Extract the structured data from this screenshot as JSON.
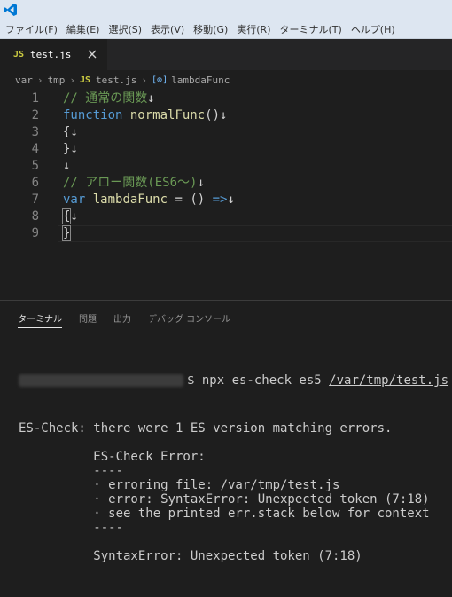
{
  "app": {
    "accent": "#0078d4",
    "icon": "vscode-logo"
  },
  "menu": [
    "ファイル(F)",
    "編集(E)",
    "選択(S)",
    "表示(V)",
    "移動(G)",
    "実行(R)",
    "ターミナル(T)",
    "ヘルプ(H)"
  ],
  "tab": {
    "badge": "JS",
    "label": "test.js",
    "close_icon": "close-icon"
  },
  "breadcrumb": {
    "items": [
      "var",
      "tmp",
      "test.js",
      "lambdaFunc"
    ],
    "file_badge": "JS",
    "symbol_icon": "cube-icon"
  },
  "editor": {
    "line_numbers": [
      "1",
      "2",
      "3",
      "4",
      "5",
      "6",
      "7",
      "8",
      "9"
    ],
    "lines": [
      [
        {
          "t": "// 通常の関数",
          "c": "cm"
        },
        {
          "t": "↓",
          "c": "nl"
        }
      ],
      [
        {
          "t": "function",
          "c": "kw"
        },
        {
          "t": " ",
          "c": "pl"
        },
        {
          "t": "normalFunc",
          "c": "fn"
        },
        {
          "t": "()",
          "c": "pl"
        },
        {
          "t": "↓",
          "c": "nl"
        }
      ],
      [
        {
          "t": "{",
          "c": "pl"
        },
        {
          "t": "↓",
          "c": "nl"
        }
      ],
      [
        {
          "t": "}",
          "c": "pl"
        },
        {
          "t": "↓",
          "c": "nl"
        }
      ],
      [
        {
          "t": "↓",
          "c": "nl"
        }
      ],
      [
        {
          "t": "// アロー関数(ES6～)",
          "c": "cm"
        },
        {
          "t": "↓",
          "c": "nl"
        }
      ],
      [
        {
          "t": "var",
          "c": "kw"
        },
        {
          "t": " ",
          "c": "pl"
        },
        {
          "t": "lambdaFunc",
          "c": "fn"
        },
        {
          "t": " = () ",
          "c": "pl"
        },
        {
          "t": "=>",
          "c": "kw"
        },
        {
          "t": "↓",
          "c": "nl"
        }
      ],
      [
        {
          "t": "{",
          "c": "pl"
        },
        {
          "t": "↓",
          "c": "nl"
        }
      ],
      [
        {
          "t": "}",
          "c": "pl"
        }
      ]
    ]
  },
  "panel": {
    "tabs": [
      "ターミナル",
      "問題",
      "出力",
      "デバッグ コンソール"
    ],
    "active_tab": "ターミナル"
  },
  "terminal": {
    "command": "$ npx es-check es5 ",
    "command_path": "/var/tmp/test.js",
    "lines": [
      "ES-Check: there were 1 ES version matching errors.",
      "",
      "          ES-Check Error:",
      "          ----",
      "          · erroring file: /var/tmp/test.js",
      "          · error: SyntaxError: Unexpected token (7:18)",
      "          · see the printed err.stack below for context",
      "          ----",
      "",
      "          SyntaxError: Unexpected token (7:18)"
    ]
  }
}
